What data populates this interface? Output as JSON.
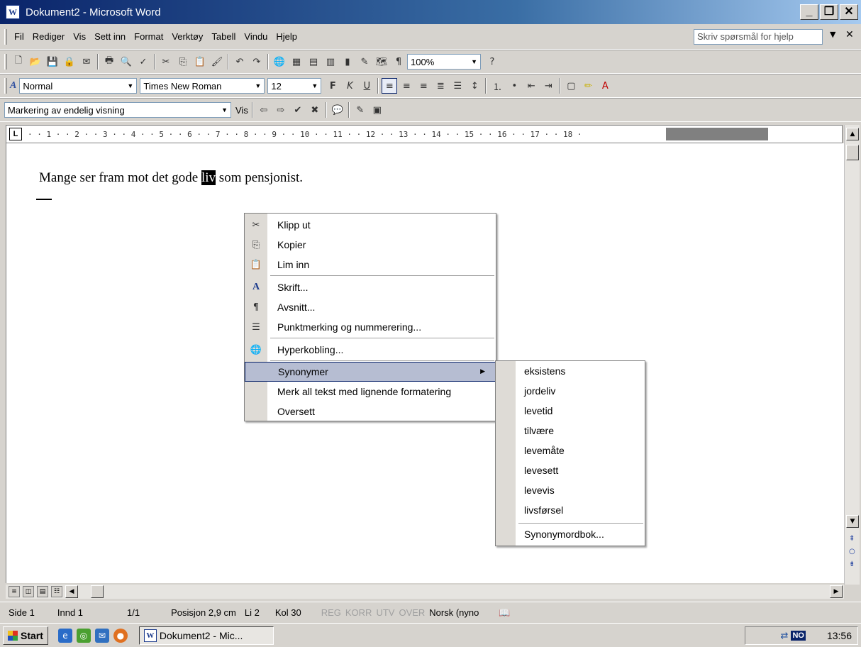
{
  "window": {
    "title": "Dokument2 - Microsoft Word",
    "app_icon": "W"
  },
  "menubar": {
    "items": [
      "Fil",
      "Rediger",
      "Vis",
      "Sett inn",
      "Format",
      "Verktøy",
      "Tabell",
      "Vindu",
      "Hjelp"
    ],
    "help_placeholder": "Skriv spørsmål for hjelp"
  },
  "toolbar_standard": {
    "zoom": "100%"
  },
  "toolbar_format": {
    "style": "Normal",
    "font": "Times New Roman",
    "size": "12"
  },
  "toolbar_review": {
    "markup_view": "Markering av endelig visning",
    "show_label": "Vis"
  },
  "ruler": {
    "scale": "· · 1 · · 2 · · 3 · · 4 · · 5 · · 6 · · 7 · · 8 · · 9 · · 10 · · 11 · · 12 · · 13 · · 14 · · 15 · · 16 · · 17 · · 18 ·",
    "tab_stop": "L"
  },
  "document": {
    "before": "Mange ser fram mot det gode ",
    "selected": "liv",
    "after": " som pensjonist."
  },
  "context_menu": {
    "items": [
      {
        "label": "Klipp ut",
        "icon": "scissors-icon"
      },
      {
        "label": "Kopier",
        "icon": "copy-icon"
      },
      {
        "label": "Lim inn",
        "icon": "paste-icon"
      },
      {
        "label": "Skrift...",
        "icon": "font-icon"
      },
      {
        "label": "Avsnitt...",
        "icon": "paragraph-icon"
      },
      {
        "label": "Punktmerking og nummerering...",
        "icon": "bullets-icon"
      },
      {
        "label": "Hyperkobling...",
        "icon": "hyperlink-icon"
      },
      {
        "label": "Synonymer",
        "icon": ""
      },
      {
        "label": "Merk all tekst med lignende formatering",
        "icon": ""
      },
      {
        "label": "Oversett",
        "icon": ""
      }
    ]
  },
  "submenu": {
    "items": [
      "eksistens",
      "jordeliv",
      "levetid",
      "tilvære",
      "levemåte",
      "levesett",
      "levevis",
      "livsførsel"
    ],
    "thesaurus": "Synonymordbok..."
  },
  "statusbar": {
    "page": "Side 1",
    "section": "Innd 1",
    "pages": "1/1",
    "position": "Posisjon 2,9 cm",
    "line": "Li 2",
    "column": "Kol 30",
    "rec": "REG",
    "trk": "KORR",
    "ext": "UTV",
    "ovr": "OVER",
    "language": "Norsk (nyno"
  },
  "taskbar": {
    "start": "Start",
    "task": "Dokument2 - Mic...",
    "tray_lang": "NO",
    "clock": "13:56"
  },
  "colors": {
    "title_bar": "#0a246a",
    "menu_highlight": "#b6bdd2",
    "chrome": "#d6d3ce"
  }
}
